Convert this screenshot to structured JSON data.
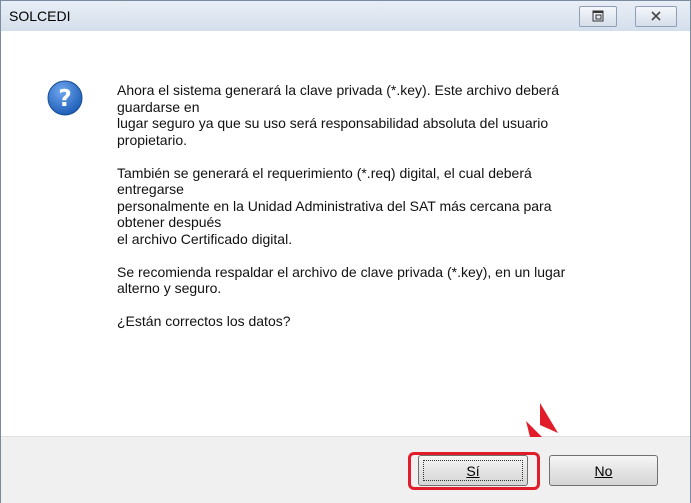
{
  "window": {
    "title": "SOLCEDI",
    "icons": {
      "restore": "restore-icon",
      "close": "close-icon"
    }
  },
  "dialog": {
    "icon": "question-icon",
    "paragraphs": [
      [
        "Ahora el sistema generará la clave privada (*.key). Este archivo deberá",
        "guardarse en",
        "lugar seguro ya que su uso será responsabilidad absoluta del usuario",
        "propietario."
      ],
      [
        "También se generará el requerimiento (*.req) digital, el cual deberá",
        "entregarse",
        "personalmente en la Unidad Administrativa del SAT más cercana para",
        "obtener después",
        "el archivo Certificado digital."
      ],
      [
        "Se recomienda respaldar el archivo de clave privada (*.key), en un lugar",
        "alterno y seguro."
      ],
      [
        "¿Están correctos los datos?"
      ]
    ]
  },
  "buttons": {
    "yes": "Sí",
    "no": "No"
  },
  "colors": {
    "highlight": "#e21d2b",
    "arrow": "#e21d2b",
    "question_icon": "#1f5fb8"
  }
}
